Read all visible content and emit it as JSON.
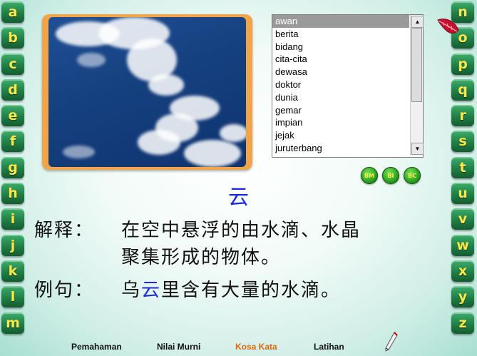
{
  "letters_left": [
    "a",
    "b",
    "c",
    "d",
    "e",
    "f",
    "g",
    "h",
    "i",
    "j",
    "k",
    "l",
    "m"
  ],
  "letters_right": [
    "n",
    "o",
    "p",
    "q",
    "r",
    "s",
    "t",
    "u",
    "v",
    "w",
    "x",
    "y",
    "z"
  ],
  "word_list": {
    "items": [
      "awan",
      "berita",
      "bidang",
      "cita-cita",
      "dewasa",
      "doktor",
      "dunia",
      "gemar",
      "impian",
      "jejak",
      "juruterbang"
    ],
    "selected": "awan"
  },
  "lang_buttons": [
    "BM",
    "BI",
    "BC"
  ],
  "word": "云",
  "definition": {
    "label": "解释：",
    "line1": "在空中悬浮的由水滴、水晶",
    "line2": "聚集形成的物体。"
  },
  "example": {
    "label": "例句：",
    "part1": "乌",
    "highlight": "云",
    "part2": "里含有大量的水滴。"
  },
  "nav": {
    "items": [
      "Pemahaman",
      "Nilai Murni",
      "Kosa Kata",
      "Latihan"
    ],
    "active": "Kosa Kata"
  },
  "colors": {
    "letter_text": "#ffe94a",
    "letter_bg": "#1f7f45",
    "highlight": "#1d2bd6",
    "nav_active": "#d96b0c",
    "frame": "#f2a447"
  },
  "icons": {
    "close": "close-icon",
    "pen": "pen-icon",
    "scroll_up": "scroll-up-icon",
    "scroll_down": "scroll-down-icon"
  }
}
